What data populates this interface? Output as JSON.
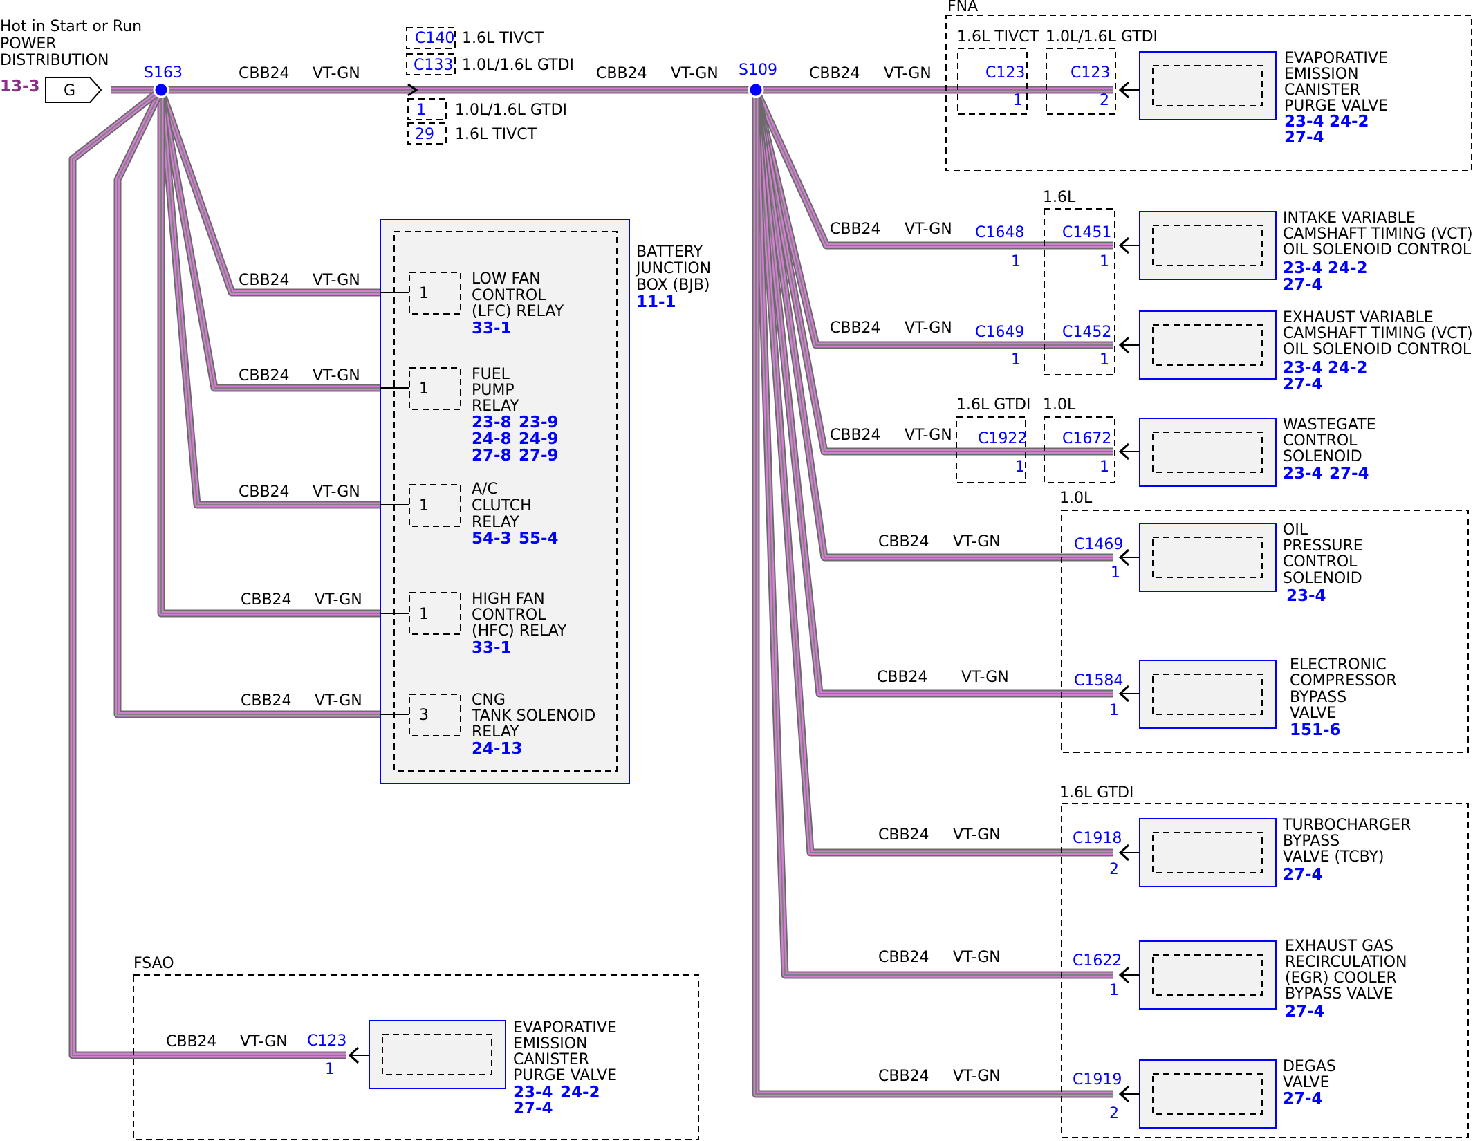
{
  "power": {
    "line1": "Hot in Start or Run",
    "line2": "POWER",
    "line3": "DISTRIBUTION",
    "ref": "13-3",
    "pin": "G"
  },
  "splices": {
    "s163": "S163",
    "s109": "S109"
  },
  "wire": {
    "circuit": "CBB24",
    "color": "VT-GN"
  },
  "inline_connectors": {
    "c140": "C140",
    "c140_label": "1.6L TIVCT",
    "c133": "C133",
    "c133_label": "1.0L/1.6L GTDI",
    "pin1": "1",
    "pin1_label": "1.0L/1.6L GTDI",
    "pin29": "29",
    "pin29_label": "1.6L TIVCT"
  },
  "bjb": {
    "title1": "BATTERY",
    "title2": "JUNCTION",
    "title3": "BOX (BJB)",
    "ref": "11-1",
    "relays": [
      {
        "pin": "1",
        "l1": "LOW FAN",
        "l2": "CONTROL",
        "l3": "(LFC) RELAY",
        "r1": "33-1",
        "r2": "",
        "r3": "",
        "r4": "",
        "r5": "",
        "r6": ""
      },
      {
        "pin": "1",
        "l1": "FUEL",
        "l2": "PUMP",
        "l3": "RELAY",
        "r1": "23-8",
        "r2": "23-9",
        "r3": "24-8",
        "r4": "24-9",
        "r5": "27-8",
        "r6": "27-9"
      },
      {
        "pin": "1",
        "l1": "A/C",
        "l2": "CLUTCH",
        "l3": "RELAY",
        "r1": "54-3",
        "r2": "55-4",
        "r3": "",
        "r4": "",
        "r5": "",
        "r6": ""
      },
      {
        "pin": "1",
        "l1": "HIGH FAN",
        "l2": "CONTROL",
        "l3": "(HFC) RELAY",
        "r1": "33-1",
        "r2": "",
        "r3": "",
        "r4": "",
        "r5": "",
        "r6": ""
      },
      {
        "pin": "3",
        "l1": "CNG",
        "l2": "TANK SOLENOID",
        "l3": "RELAY",
        "r1": "24-13",
        "r2": "",
        "r3": "",
        "r4": "",
        "r5": "",
        "r6": ""
      }
    ]
  },
  "groups": {
    "fna": "FNA",
    "fna_tivct": "1.6L TIVCT",
    "fna_gtdi": "1.0L/1.6L GTDI",
    "vct": "1.6L",
    "wg_gtdi": "1.6L GTDI",
    "wg_10": "1.0L",
    "opc": "1.0L",
    "gtdi": "1.6L GTDI",
    "fsao": "FSAO"
  },
  "components": {
    "evap_fna": {
      "c1": "C123",
      "p1": "1",
      "c2": "C123",
      "p2": "2",
      "l1": "EVAPORATIVE",
      "l2": "EMISSION",
      "l3": "CANISTER",
      "l4": "PURGE VALVE",
      "r1": "23-4",
      "r2": "24-2",
      "r3": "27-4"
    },
    "intake_vct": {
      "c1": "C1648",
      "p1": "1",
      "c2": "C1451",
      "p2": "1",
      "l1": "INTAKE VARIABLE",
      "l2": "CAMSHAFT TIMING (VCT)",
      "l3": "OIL SOLENOID CONTROL",
      "r1": "23-4",
      "r2": "24-2",
      "r3": "27-4"
    },
    "exhaust_vct": {
      "c1": "C1649",
      "p1": "1",
      "c2": "C1452",
      "p2": "1",
      "l1": "EXHAUST VARIABLE",
      "l2": "CAMSHAFT TIMING (VCT)",
      "l3": "OIL SOLENOID CONTROL",
      "r1": "23-4",
      "r2": "24-2",
      "r3": "27-4"
    },
    "wastegate": {
      "c1": "C1922",
      "p1": "1",
      "c2": "C1672",
      "p2": "1",
      "l1": "WASTEGATE",
      "l2": "CONTROL",
      "l3": "SOLENOID",
      "r1": "23-4",
      "r2": "27-4"
    },
    "oil_pressure": {
      "c": "C1469",
      "p": "1",
      "l1": "OIL",
      "l2": "PRESSURE",
      "l3": "CONTROL",
      "l4": "SOLENOID",
      "r1": "23-4"
    },
    "compressor": {
      "c": "C1584",
      "p": "1",
      "l1": "ELECTRONIC",
      "l2": "COMPRESSOR",
      "l3": "BYPASS",
      "l4": "VALVE",
      "r1": "151-6"
    },
    "turbo": {
      "c": "C1918",
      "p": "2",
      "l1": "TURBOCHARGER",
      "l2": "BYPASS",
      "l3": "VALVE (TCBY)",
      "r1": "27-4"
    },
    "egr": {
      "c": "C1622",
      "p": "1",
      "l1": "EXHAUST GAS",
      "l2": "RECIRCULATION",
      "l3": "(EGR) COOLER",
      "l4": "BYPASS VALVE",
      "r1": "27-4"
    },
    "degas": {
      "c": "C1919",
      "p": "2",
      "l1": "DEGAS",
      "l2": "VALVE",
      "r1": "27-4"
    },
    "evap_fsao": {
      "c": "C123",
      "p": "1",
      "l1": "EVAPORATIVE",
      "l2": "EMISSION",
      "l3": "CANISTER",
      "l4": "PURGE VALVE",
      "r1": "23-4",
      "r2": "24-2",
      "r3": "27-4"
    }
  },
  "colors": {
    "wire_outer": "#6a6a6a",
    "wire_mid": "#d27fd2",
    "wire_center": "#7f7f7f",
    "splice": "#0000ff",
    "ref": "#0000ff",
    "power_ref": "#8b2f8b"
  }
}
